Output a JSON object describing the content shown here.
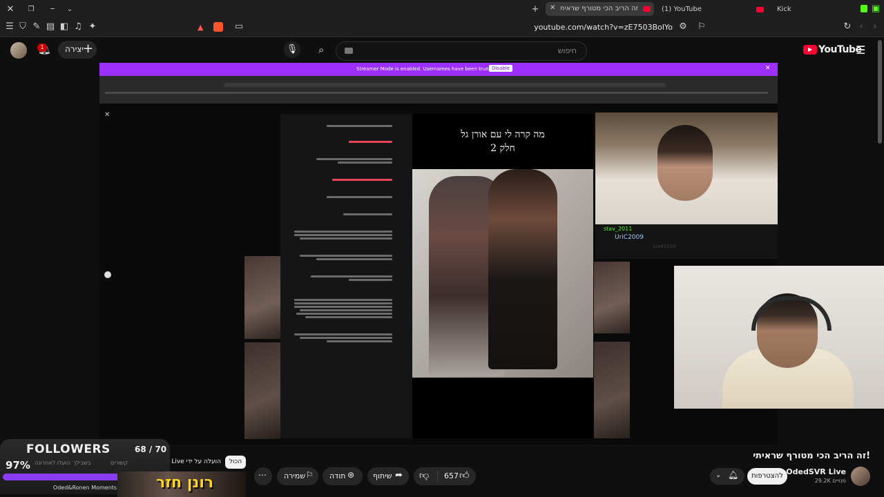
{
  "browser": {
    "tabs": [
      {
        "label": "זה הריב הכי מטורף שראיתי! (1)",
        "active": true
      },
      {
        "label": "(1) YouTube",
        "active": false
      },
      {
        "label": "Kick",
        "active": false
      }
    ],
    "new_tab_symbol": "+",
    "url": "youtube.com/watch?v=zE7503BoIYo"
  },
  "youtube": {
    "logo_text": "YouTube",
    "search_placeholder": "חיפוש",
    "create_label": "יצירה",
    "notification_count": "1"
  },
  "player": {
    "streamer_banner_text": "Streamer Mode is enabled. Usernames have been truncated.",
    "disable_label": "Disable",
    "video_caption_line1": "מה קרה לי עם אורן גל",
    "video_caption_line2": "חלק 2",
    "chat_user1": "stav_2011",
    "chat_user2": "UriC2009",
    "chat_user3": "Liad1010"
  },
  "video": {
    "title": "זה הריב הכי מטורף שראיתי!",
    "channel_name": "OdedSVR Live",
    "subscriber_count": "29.2K מנויים",
    "subscribe_label": "להצטרפות",
    "likes": "657",
    "share_label": "שיתוף",
    "thanks_label": "תודה",
    "save_label": "שמירה"
  },
  "chips": {
    "all": "הכול",
    "uploaded_by": "הועלה על ידי OdedSVR Live",
    "related": "קשורים",
    "recent": "בשבילך",
    "uploaded": "הועלו לאחרונה"
  },
  "overlay": {
    "followers_label": "FOLLOWERS",
    "followers_count": "68 / 70",
    "followers_percent": "97%",
    "followers_progress": 0.97,
    "bottom_caption": "Oded&Ronen Moments",
    "bottom_banner_text": "רונן חזר"
  },
  "colors": {
    "accent_purple": "#9b30ff",
    "youtube_red": "#ff0033",
    "background": "#0f0f0f"
  }
}
